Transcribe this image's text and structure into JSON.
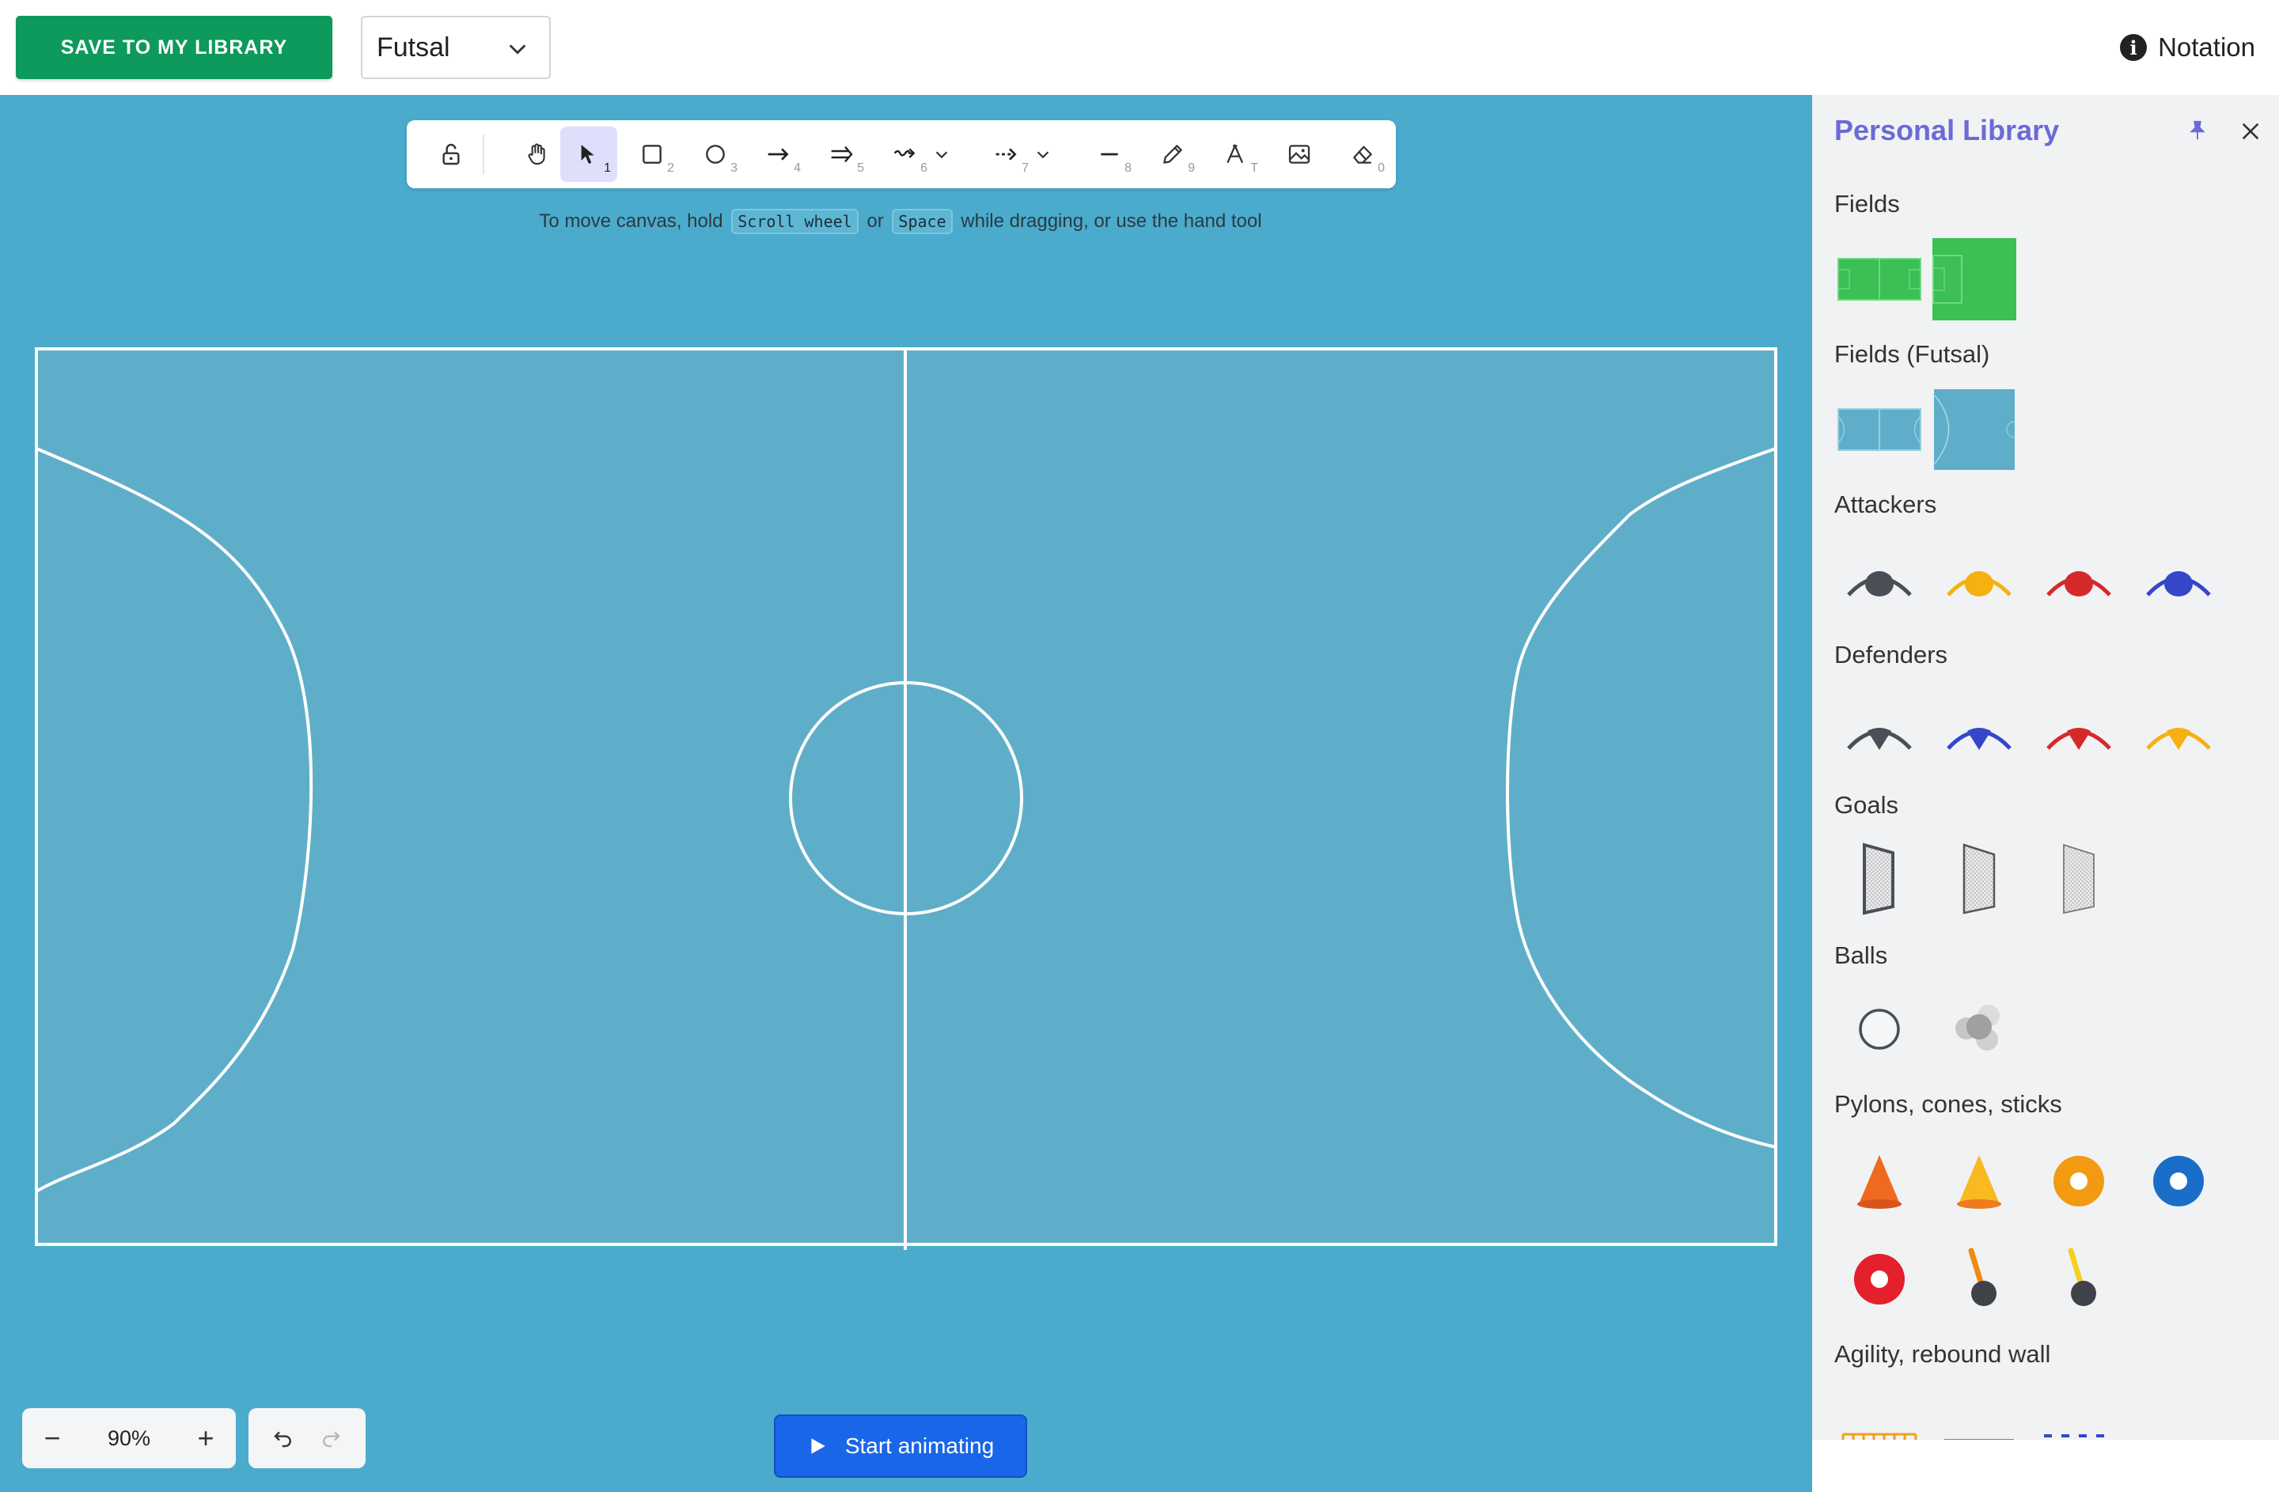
{
  "topbar": {
    "save_label": "SAVE TO MY LIBRARY",
    "sport_value": "Futsal",
    "notation_label": "Notation"
  },
  "toolbar": {
    "tools": [
      {
        "name": "lock",
        "num": ""
      },
      {
        "name": "hand",
        "num": ""
      },
      {
        "name": "selection",
        "num": "1"
      },
      {
        "name": "rectangle",
        "num": "2"
      },
      {
        "name": "ellipse",
        "num": "3"
      },
      {
        "name": "arrow",
        "num": "4"
      },
      {
        "name": "double-arrow",
        "num": "5"
      },
      {
        "name": "wave-arrow",
        "num": "6"
      },
      {
        "name": "dashed-arrow",
        "num": "7"
      },
      {
        "name": "line",
        "num": "8"
      },
      {
        "name": "pencil",
        "num": "9"
      },
      {
        "name": "text",
        "num": "T"
      },
      {
        "name": "image",
        "num": ""
      },
      {
        "name": "eraser",
        "num": "0"
      }
    ],
    "active_tool": "selection"
  },
  "hint": {
    "prefix": "To move canvas, hold",
    "key1": "Scroll wheel",
    "middle": "or",
    "key2": "Space",
    "suffix": "while dragging, or use the hand tool"
  },
  "zoom": {
    "value": "90%",
    "minus": "−",
    "plus": "+"
  },
  "animate": {
    "label": "Start animating"
  },
  "library": {
    "title": "Personal Library",
    "sections": {
      "fields": "Fields",
      "fields_futsal": "Fields (Futsal)",
      "attackers": "Attackers",
      "defenders": "Defenders",
      "goals": "Goals",
      "balls": "Balls",
      "pylons": "Pylons, cones, sticks",
      "agility": "Agility, rebound wall"
    }
  },
  "colors": {
    "canvas": "#4babcc",
    "pitch": "#5faec9",
    "save_button": "#0d9a5c",
    "accent": "#6b6bd6",
    "animate_button": "#1a66e8",
    "player_dark": "#4a4f57",
    "player_yellow": "#f5b011",
    "player_red": "#d42a2a",
    "player_blue": "#3347c8"
  }
}
